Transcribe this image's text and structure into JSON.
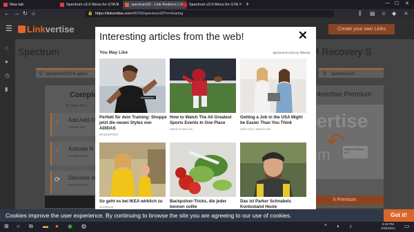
{
  "browser": {
    "tabs": [
      {
        "label": "New tab",
        "favicon_color": "#e04040"
      },
      {
        "label": "Spectrum v2.0 Menu for GTA V",
        "favicon_color": "#e04040"
      },
      {
        "label": "spectrum20 - Link Redirect | Li",
        "favicon_color": "#e0652f"
      },
      {
        "label": "Spectrum v2.0 Menu for GTA",
        "favicon_color": "#e02020"
      }
    ],
    "url_host": "https://linkvertise.com",
    "url_path": "/45763/spectrum20?o=sharing"
  },
  "site": {
    "logo_pre": "Link",
    "logo_post": "vertise",
    "create_button": "Create your own Links",
    "title_left": "Spectrum",
    "title_right": "5M Recovery S",
    "search_left": "spectrum200-h spect",
    "search_right": "spectrum29",
    "card_title": "Comple",
    "card_sub": "To reach the t",
    "steps": [
      {
        "title": "Add Add-O",
        "desc": "Add the exte",
        "icon": "✓"
      },
      {
        "title": "Activate N",
        "desc": "Activate notific",
        "icon": "✓"
      },
      {
        "title": "Discover in",
        "desc": "Read articles f",
        "icon": "⟳"
      }
    ],
    "premium_title": "Linkvertise Premium",
    "video_word": "vertise",
    "video_word2": "ium",
    "video_menu": "Spectrum Menu v2.2",
    "premium_button": "h Premium"
  },
  "modal": {
    "title": "Interesting articles from the web!",
    "close": "✕",
    "you_may_like": "You May Like",
    "sponsored": "Sponsored Links by Taboola",
    "items": [
      {
        "title": "Perfekt für dein Training: Shoppe jetzt die neuen Styles von ADIDAS",
        "source": "INTERSPORT"
      },
      {
        "title": "How to Watch The All Greatest Sports Events In One Place",
        "source": "watch-it-now.com"
      },
      {
        "title": "Getting a Job in the USA Might be Easier Than You Think",
        "source": "Jobs USA | Search Ads"
      },
      {
        "title": "So geht es bei IKEA wirklich zu",
        "source": "Novaweep"
      },
      {
        "title": "Backpulver-Tricks, die jeder kennen sollte",
        "source": ""
      },
      {
        "title": "Das ist Parker Schnabels Kontostand Heute",
        "source": ""
      }
    ],
    "thumb_labels": {
      "intersport": "INTERSPORT"
    }
  },
  "cookie": {
    "text": "Cookies improve the user experience. By continuing to browse the site you are agreeing to our use of cookies.",
    "button": "Got it!"
  },
  "taskbar": {
    "time": "6:49 PM",
    "date": "2/26/2021"
  },
  "colors": {
    "accent": "#d9672c",
    "cookie_bg": "#2f3846"
  }
}
